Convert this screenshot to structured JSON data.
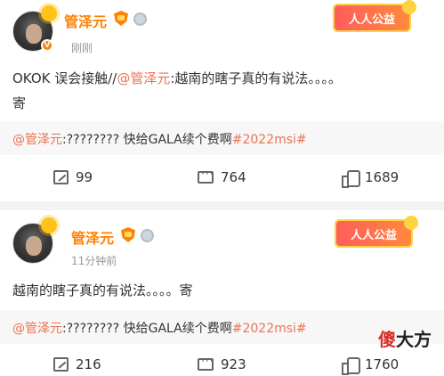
{
  "posts": [
    {
      "user": "管泽元",
      "time": "刚刚",
      "charity": "人人公益",
      "text_lines": [
        "OKOK 误会接触//",
        "@管泽元",
        ":越南的瞎子真的有说法。。。。",
        "寄"
      ],
      "repost": {
        "mention": "@管泽元",
        "body": ":???????? 快给GALA续个费啊",
        "hashtag": "#2022msi#"
      },
      "actions": {
        "forward": "99",
        "comment": "764",
        "like": "1689"
      }
    },
    {
      "user": "管泽元",
      "time": "11分钟前",
      "charity": "人人公益",
      "text": "越南的瞎子真的有说法。。。。寄",
      "repost": {
        "mention": "@管泽元",
        "body": ":???????? 快给GALA续个费啊",
        "hashtag": "#2022msi#"
      },
      "actions": {
        "forward": "216",
        "comment": "923",
        "like": "1760"
      }
    }
  ],
  "watermark": {
    "red": "傻",
    "black": "大方"
  }
}
